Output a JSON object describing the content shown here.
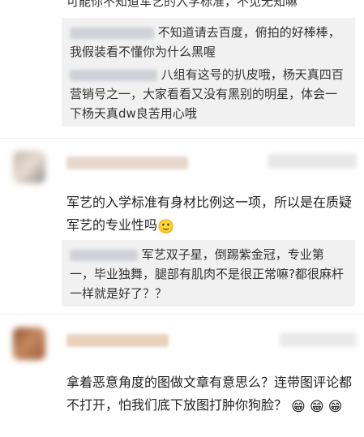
{
  "top_text": "可能你不知道军艺的入学标准，不见无知嘛",
  "replies_1": [
    {
      "text": "不知道请去百度，俯拍的好棒棒，我假装看不懂你为什么黑喔"
    },
    {
      "text": "八组有这号的扒皮哦，杨天真四百营销号之一，大家看看又没有黑别的明星，体会一下杨天真dw良苦用心哦"
    }
  ],
  "comment_1": {
    "text": "军艺的入学标准有身材比例这一项，所以是在质疑军艺的专业性吗",
    "emoji": "🙂"
  },
  "replies_2": [
    {
      "text": "军艺双子星，倒踢紫金冠，专业第一，毕业独舞，腿部有肌肉不是很正常嘛?都很麻杆一样就是好了？？"
    }
  ],
  "comment_2": {
    "text": "拿着恶意角度的图做文章有意思么？连带图评论都不打开，怕我们底下放图打肿你狗脸？",
    "emojis": [
      "😁",
      "😁",
      "😁"
    ]
  },
  "colors": {
    "reply_bg": "#f1f1f1",
    "link": "#5d7cb0"
  }
}
